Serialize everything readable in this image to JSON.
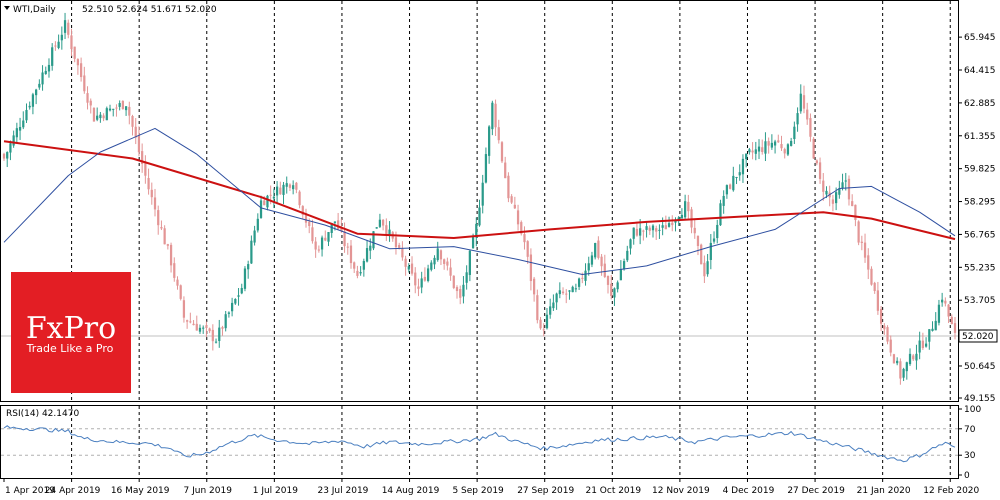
{
  "header": {
    "symbol": "WTI,Daily",
    "ohlc": "52.510 52.624 51.671 52.020"
  },
  "price_axis_labels": [
    "65.945",
    "64.415",
    "62.885",
    "61.355",
    "59.825",
    "58.295",
    "56.765",
    "55.235",
    "53.705",
    "52.020",
    "50.645",
    "49.155"
  ],
  "rsi_axis_labels": [
    "100",
    "70",
    "30",
    "0"
  ],
  "date_labels": [
    "1 Apr 2019",
    "24 Apr 2019",
    "16 May 2019",
    "7 Jun 2019",
    "1 Jul 2019",
    "23 Jul 2019",
    "14 Aug 2019",
    "5 Sep 2019",
    "27 Sep 2019",
    "21 Oct 2019",
    "12 Nov 2019",
    "4 Dec 2019",
    "27 Dec 2019",
    "21 Jan 2020",
    "12 Feb 2020"
  ],
  "rsi_header": "RSI(14) 42.1470",
  "current_price": "52.020",
  "logo": {
    "brand": "FxPro",
    "tagline": "Trade Like a Pro"
  },
  "colors": {
    "bull": "#2a9a8a",
    "bear": "#e39595",
    "ma_long": "#cc1111",
    "ma_short": "#2e4fa0",
    "rsi_line": "#4a7fc0",
    "logo_bg": "#e31e24"
  },
  "chart_data": [
    {
      "type": "candlestick",
      "title": "WTI,Daily",
      "ylim": [
        49.155,
        67.3
      ],
      "x": [
        "1 Apr 2019",
        "24 Apr 2019",
        "16 May 2019",
        "7 Jun 2019",
        "1 Jul 2019",
        "23 Jul 2019",
        "14 Aug 2019",
        "5 Sep 2019",
        "27 Sep 2019",
        "21 Oct 2019",
        "12 Nov 2019",
        "4 Dec 2019",
        "27 Dec 2019",
        "21 Jan 2020",
        "12 Feb 2020"
      ],
      "key_points": [
        {
          "x": 0,
          "close": 60.3
        },
        {
          "x": 14,
          "close": 64.9
        },
        {
          "x": 19,
          "close": 66.5
        },
        {
          "x": 28,
          "close": 62.2
        },
        {
          "x": 38,
          "close": 62.9
        },
        {
          "x": 45,
          "close": 58.9
        },
        {
          "x": 52,
          "close": 55.5
        },
        {
          "x": 56,
          "close": 52.9
        },
        {
          "x": 66,
          "close": 51.9
        },
        {
          "x": 74,
          "close": 54.3
        },
        {
          "x": 80,
          "close": 58.3
        },
        {
          "x": 90,
          "close": 59.3
        },
        {
          "x": 97,
          "close": 56.0
        },
        {
          "x": 103,
          "close": 57.4
        },
        {
          "x": 110,
          "close": 54.9
        },
        {
          "x": 117,
          "close": 57.6
        },
        {
          "x": 124,
          "close": 55.6
        },
        {
          "x": 129,
          "close": 54.2
        },
        {
          "x": 135,
          "close": 56.2
        },
        {
          "x": 142,
          "close": 53.7
        },
        {
          "x": 147,
          "close": 57.1
        },
        {
          "x": 152,
          "close": 62.8
        },
        {
          "x": 157,
          "close": 58.6
        },
        {
          "x": 162,
          "close": 56.4
        },
        {
          "x": 167,
          "close": 52.2
        },
        {
          "x": 172,
          "close": 53.9
        },
        {
          "x": 178,
          "close": 54.1
        },
        {
          "x": 184,
          "close": 56.3
        },
        {
          "x": 189,
          "close": 53.8
        },
        {
          "x": 196,
          "close": 56.9
        },
        {
          "x": 205,
          "close": 57.0
        },
        {
          "x": 212,
          "close": 58.1
        },
        {
          "x": 218,
          "close": 55.0
        },
        {
          "x": 224,
          "close": 58.6
        },
        {
          "x": 232,
          "close": 60.5
        },
        {
          "x": 240,
          "close": 61.1
        },
        {
          "x": 244,
          "close": 60.7
        },
        {
          "x": 248,
          "close": 63.2
        },
        {
          "x": 254,
          "close": 59.2
        },
        {
          "x": 258,
          "close": 58.2
        },
        {
          "x": 262,
          "close": 59.3
        },
        {
          "x": 266,
          "close": 56.6
        },
        {
          "x": 270,
          "close": 54.6
        },
        {
          "x": 274,
          "close": 52.3
        },
        {
          "x": 279,
          "close": 50.2
        },
        {
          "x": 283,
          "close": 51.2
        },
        {
          "x": 288,
          "close": 52.1
        },
        {
          "x": 292,
          "close": 53.9
        },
        {
          "x": 296,
          "close": 52.0
        }
      ],
      "series": [
        {
          "name": "MA long",
          "values": [
            {
              "x": 0,
              "y": 61.1
            },
            {
              "x": 40,
              "y": 60.3
            },
            {
              "x": 80,
              "y": 58.5
            },
            {
              "x": 110,
              "y": 56.8
            },
            {
              "x": 140,
              "y": 56.6
            },
            {
              "x": 170,
              "y": 57.0
            },
            {
              "x": 200,
              "y": 57.35
            },
            {
              "x": 230,
              "y": 57.6
            },
            {
              "x": 255,
              "y": 57.8
            },
            {
              "x": 270,
              "y": 57.5
            },
            {
              "x": 285,
              "y": 56.95
            },
            {
              "x": 296,
              "y": 56.55
            }
          ]
        },
        {
          "name": "MA short",
          "values": [
            {
              "x": 0,
              "y": 56.4
            },
            {
              "x": 20,
              "y": 59.5
            },
            {
              "x": 30,
              "y": 60.6
            },
            {
              "x": 47,
              "y": 61.7
            },
            {
              "x": 60,
              "y": 60.5
            },
            {
              "x": 80,
              "y": 58.0
            },
            {
              "x": 100,
              "y": 57.2
            },
            {
              "x": 120,
              "y": 56.1
            },
            {
              "x": 140,
              "y": 56.2
            },
            {
              "x": 160,
              "y": 55.6
            },
            {
              "x": 180,
              "y": 54.9
            },
            {
              "x": 200,
              "y": 55.3
            },
            {
              "x": 220,
              "y": 56.2
            },
            {
              "x": 240,
              "y": 57.0
            },
            {
              "x": 260,
              "y": 58.9
            },
            {
              "x": 270,
              "y": 59.0
            },
            {
              "x": 285,
              "y": 57.8
            },
            {
              "x": 296,
              "y": 56.7
            }
          ]
        }
      ]
    },
    {
      "type": "line",
      "title": "RSI(14) 42.1470",
      "ylim": [
        0,
        100
      ],
      "series": [
        {
          "name": "RSI(14)",
          "values": [
            {
              "x": 0,
              "y": 72
            },
            {
              "x": 10,
              "y": 70
            },
            {
              "x": 20,
              "y": 66
            },
            {
              "x": 25,
              "y": 55
            },
            {
              "x": 35,
              "y": 50
            },
            {
              "x": 45,
              "y": 48
            },
            {
              "x": 52,
              "y": 40
            },
            {
              "x": 56,
              "y": 28
            },
            {
              "x": 62,
              "y": 32
            },
            {
              "x": 70,
              "y": 48
            },
            {
              "x": 78,
              "y": 60
            },
            {
              "x": 85,
              "y": 53
            },
            {
              "x": 95,
              "y": 47
            },
            {
              "x": 105,
              "y": 52
            },
            {
              "x": 112,
              "y": 43
            },
            {
              "x": 120,
              "y": 50
            },
            {
              "x": 130,
              "y": 47
            },
            {
              "x": 140,
              "y": 51
            },
            {
              "x": 148,
              "y": 55
            },
            {
              "x": 153,
              "y": 62
            },
            {
              "x": 160,
              "y": 50
            },
            {
              "x": 168,
              "y": 40
            },
            {
              "x": 175,
              "y": 45
            },
            {
              "x": 185,
              "y": 53
            },
            {
              "x": 195,
              "y": 55
            },
            {
              "x": 205,
              "y": 58
            },
            {
              "x": 215,
              "y": 50
            },
            {
              "x": 225,
              "y": 57
            },
            {
              "x": 235,
              "y": 60
            },
            {
              "x": 245,
              "y": 64
            },
            {
              "x": 250,
              "y": 58
            },
            {
              "x": 256,
              "y": 50
            },
            {
              "x": 262,
              "y": 43
            },
            {
              "x": 268,
              "y": 36
            },
            {
              "x": 274,
              "y": 28
            },
            {
              "x": 280,
              "y": 22
            },
            {
              "x": 285,
              "y": 30
            },
            {
              "x": 291,
              "y": 45
            },
            {
              "x": 293,
              "y": 48
            },
            {
              "x": 296,
              "y": 42.147
            }
          ]
        }
      ]
    }
  ]
}
